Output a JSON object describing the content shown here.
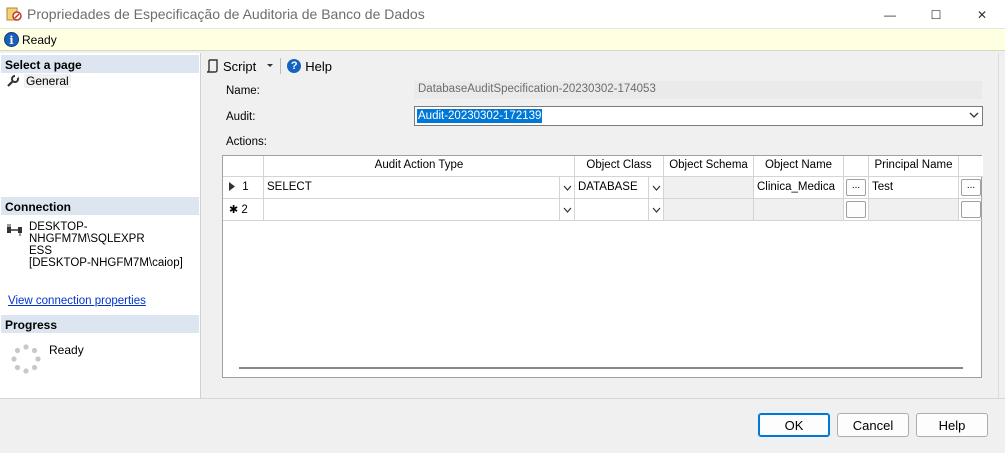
{
  "window": {
    "title": "Propriedades de Especificação de Auditoria de Banco de Dados",
    "minimize_glyph": "—",
    "maximize_glyph": "☐",
    "close_glyph": "✕"
  },
  "status": {
    "text": "Ready",
    "icon": "info-icon"
  },
  "left": {
    "select_page_header": "Select a page",
    "pages": [
      {
        "label": "General",
        "icon": "wrench-icon"
      }
    ],
    "connection_header": "Connection",
    "connection_lines": [
      "DESKTOP-NHGFM7M\\SQLEXPR",
      "ESS",
      "[DESKTOP-NHGFM7M\\caiop]"
    ],
    "connection_link": "View connection properties",
    "progress_header": "Progress",
    "progress_text": "Ready"
  },
  "toolbar": {
    "script_label": "Script",
    "help_label": "Help"
  },
  "form": {
    "name_label": "Name:",
    "name_value": "DatabaseAuditSpecification-20230302-174053",
    "audit_label": "Audit:",
    "audit_value": "Audit-20230302-172139",
    "actions_label": "Actions:"
  },
  "grid": {
    "columns": [
      "Audit Action Type",
      "Object Class",
      "Object Schema",
      "Object Name",
      "Principal Name"
    ],
    "rows": [
      {
        "marker": "1",
        "audit_action_type": "SELECT",
        "object_class": "DATABASE",
        "object_schema": "",
        "object_name": "Clinica_Medica",
        "principal_name": "Test",
        "ellipsis": "..."
      },
      {
        "marker": "2",
        "audit_action_type": "",
        "object_class": "",
        "object_schema": "",
        "object_name": "",
        "principal_name": "",
        "ellipsis": ""
      }
    ]
  },
  "buttons": {
    "ok": "OK",
    "cancel": "Cancel",
    "help": "Help"
  },
  "colors": {
    "accent": "#0078d7",
    "status_bg": "#ffffe1",
    "section_header": "#dde6f0"
  }
}
